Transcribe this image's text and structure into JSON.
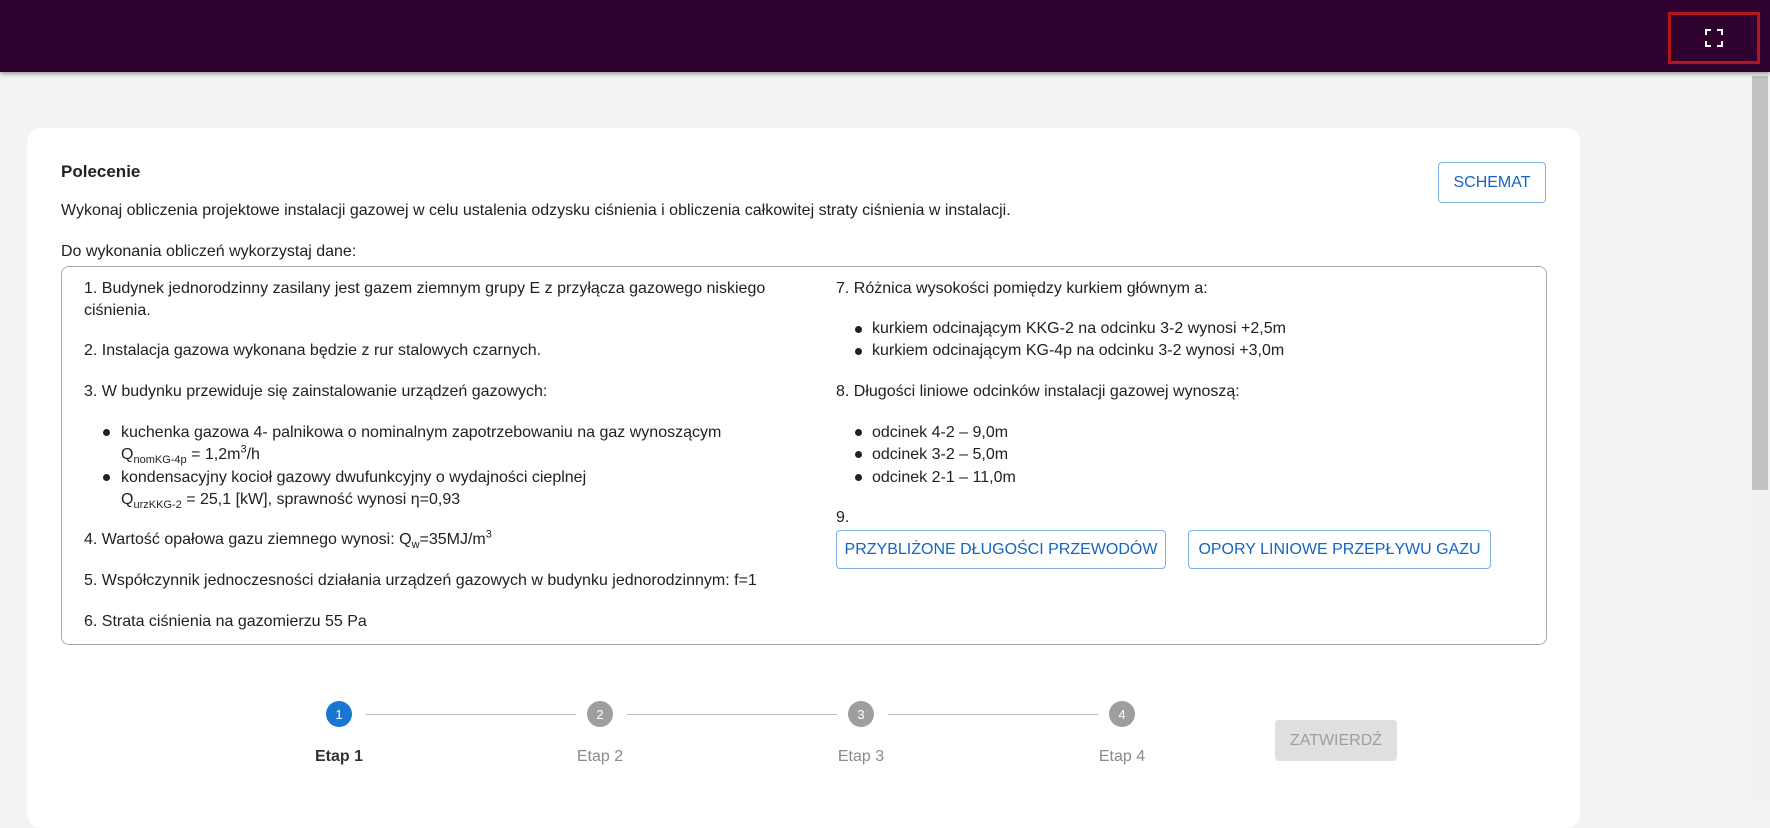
{
  "toolbar": {
    "fullscreen_icon": "fullscreen-icon"
  },
  "task": {
    "heading": "Polecenie",
    "schemat_label": "SCHEMAT",
    "intro": "Wykonaj obliczenia projektowe instalacji gazowej w celu ustalenia odzysku ciśnienia i obliczenia całkowitej straty ciśnienia w instalacji.",
    "data_intro": "Do wykonania obliczeń wykorzystaj dane:"
  },
  "items": {
    "i1_line1": "1. Budynek jednorodzinny zasilany jest gazem ziemnym grupy E z przyłącza gazowego niskiego",
    "i1_line2": "ciśnienia.",
    "i2": "2. Instalacja gazowa wykonana będzie z rur stalowych czarnych.",
    "i3": "3. W budynku przewiduje się zainstalowanie urządzeń gazowych:",
    "i3_b1_line1": "kuchenka gazowa 4- palnikowa o nominalnym zapotrzebowaniu na gaz wynoszącym",
    "i3_b1_q": "Q",
    "i3_b1_sub": "nomKG-4p",
    "i3_b1_eq": " = 1,2m",
    "i3_b1_sup": "3",
    "i3_b1_unit": "/h",
    "i3_b2_line1": "kondensacyjny kocioł gazowy dwufunkcyjny o wydajności cieplnej",
    "i3_b2_q": "Q",
    "i3_b2_sub": "urzKKG-2",
    "i3_b2_rest": " = 25,1 [kW], sprawność wynosi η=0,93",
    "i4_pre": "4. Wartość opałowa gazu ziemnego wynosi: Q",
    "i4_sub": "w",
    "i4_eq": "=35MJ/m",
    "i4_sup": "3",
    "i5": "5. Współczynnik jednoczesności działania urządzeń gazowych w budynku jednorodzinnym: f=1",
    "i6": "6. Strata ciśnienia na gazomierzu 55 Pa",
    "i7": "7. Różnica wysokości pomiędzy kurkiem głównym a:",
    "i7_b1": "kurkiem odcinającym KKG-2 na odcinku 3-2 wynosi +2,5m",
    "i7_b2": "kurkiem odcinającym KG-4p na odcinku 3-2 wynosi +3,0m",
    "i8": "8. Długości liniowe odcinków instalacji gazowej wynoszą:",
    "i8_b1": "odcinek 4-2 – 9,0m",
    "i8_b2": "odcinek 3-2 – 5,0m",
    "i8_b3": "odcinek 2-1 – 11,0m",
    "i9": "9.",
    "btn_lengths": "PRZYBLIŻONE DŁUGOŚCI PRZEWODÓW",
    "btn_resist": "OPORY LINIOWE PRZEPŁYWU GAZU"
  },
  "stepper": {
    "steps": [
      {
        "number": "1",
        "label": "Etap 1",
        "active": true
      },
      {
        "number": "2",
        "label": "Etap 2",
        "active": false
      },
      {
        "number": "3",
        "label": "Etap 3",
        "active": false
      },
      {
        "number": "4",
        "label": "Etap 4",
        "active": false
      }
    ],
    "submit_label": "ZATWIERDŹ",
    "active_color": "#1976d2",
    "inactive_color": "#9e9e9e"
  }
}
